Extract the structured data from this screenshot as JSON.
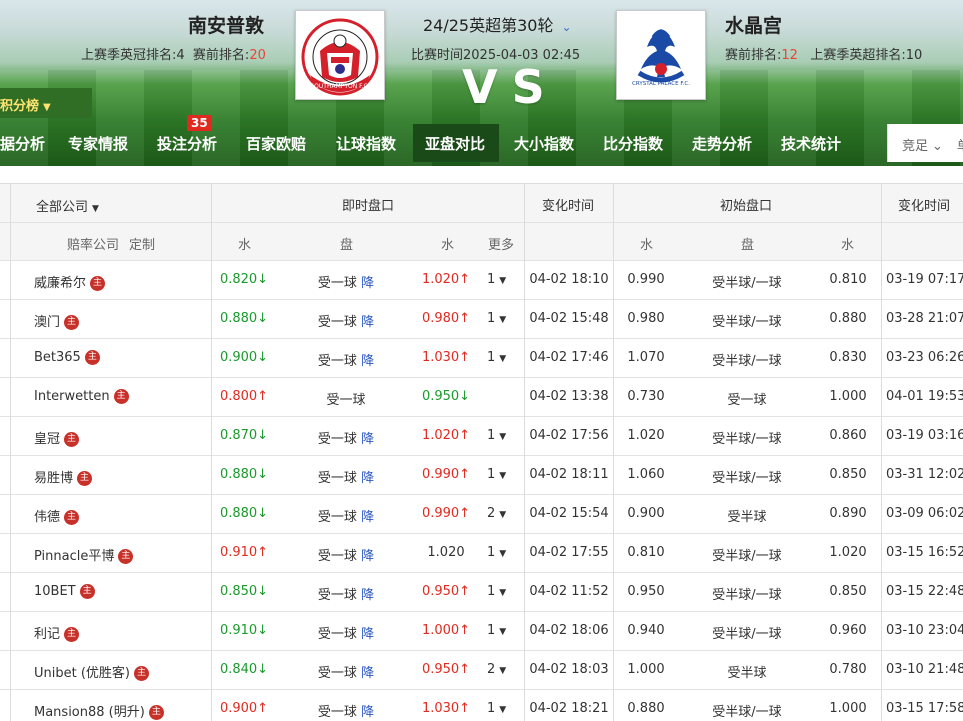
{
  "header": {
    "home_name": "南安普敦",
    "home_info_label1": "上赛季英冠排名:4",
    "home_info_label2": "赛前排名:",
    "home_rank": "20",
    "away_name": "水晶宫",
    "away_info_label1": "赛前排名:",
    "away_rank": "12",
    "away_info_label2": "上赛季英超排名:10",
    "round": "24/25英超第30轮",
    "match_time": "比赛时间2025-04-03 02:45",
    "vs": "VS",
    "rank_tab": "积分榜",
    "home_logo_text": "SOUTHAMPTON F.C.",
    "away_logo_text": "CRYSTAL PALACE F.C."
  },
  "nav": {
    "items": [
      "据分析",
      "专家情报",
      "投注分析",
      "百家欧赔",
      "让球指数",
      "亚盘对比",
      "大小指数",
      "比分指数",
      "走势分析",
      "技术统计"
    ],
    "badge": "35",
    "right_label": "竞足",
    "right_label2": "单"
  },
  "table": {
    "company_filter": "全部公司",
    "company_header": "赔率公司",
    "custom_label": "定制",
    "group_live": "即时盘口",
    "group_change_time": "变化时间",
    "group_initial": "初始盘口",
    "col_water": "水",
    "col_pan": "盘",
    "col_more": "更多",
    "home_mark": "主",
    "rows": [
      {
        "company": "威廉希尔",
        "w1": "0.820",
        "w1_dir": "down",
        "pan": "受一球",
        "pan_chg": "降",
        "w2": "1.020",
        "w2_dir": "up",
        "more": "1",
        "time": "04-02 18:10",
        "iw1": "0.990",
        "ipan": "受半球/一球",
        "iw2": "0.810",
        "itime": "03-19 07:17"
      },
      {
        "company": "澳门",
        "w1": "0.880",
        "w1_dir": "down",
        "pan": "受一球",
        "pan_chg": "降",
        "w2": "0.980",
        "w2_dir": "up",
        "more": "1",
        "time": "04-02 15:48",
        "iw1": "0.980",
        "ipan": "受半球/一球",
        "iw2": "0.880",
        "itime": "03-28 21:07"
      },
      {
        "company": "Bet365",
        "w1": "0.900",
        "w1_dir": "down",
        "pan": "受一球",
        "pan_chg": "降",
        "w2": "1.030",
        "w2_dir": "up",
        "more": "1",
        "time": "04-02 17:46",
        "iw1": "1.070",
        "ipan": "受半球/一球",
        "iw2": "0.830",
        "itime": "03-23 06:26"
      },
      {
        "company": "Interwetten",
        "w1": "0.800",
        "w1_dir": "up",
        "pan": "受一球",
        "pan_chg": "",
        "w2": "0.950",
        "w2_dir": "down",
        "more": "",
        "time": "04-02 13:38",
        "iw1": "0.730",
        "ipan": "受一球",
        "iw2": "1.000",
        "itime": "04-01 19:53"
      },
      {
        "company": "皇冠",
        "w1": "0.870",
        "w1_dir": "down",
        "pan": "受一球",
        "pan_chg": "降",
        "w2": "1.020",
        "w2_dir": "up",
        "more": "1",
        "time": "04-02 17:56",
        "iw1": "1.020",
        "ipan": "受半球/一球",
        "iw2": "0.860",
        "itime": "03-19 03:16"
      },
      {
        "company": "易胜博",
        "w1": "0.880",
        "w1_dir": "down",
        "pan": "受一球",
        "pan_chg": "降",
        "w2": "0.990",
        "w2_dir": "up",
        "more": "1",
        "time": "04-02 18:11",
        "iw1": "1.060",
        "ipan": "受半球/一球",
        "iw2": "0.850",
        "itime": "03-31 12:02"
      },
      {
        "company": "伟德",
        "w1": "0.880",
        "w1_dir": "down",
        "pan": "受一球",
        "pan_chg": "降",
        "w2": "0.990",
        "w2_dir": "up",
        "more": "2",
        "time": "04-02 15:54",
        "iw1": "0.900",
        "ipan": "受半球",
        "iw2": "0.890",
        "itime": "03-09 06:02"
      },
      {
        "company": "Pinnacle平博",
        "w1": "0.910",
        "w1_dir": "up",
        "pan": "受一球",
        "pan_chg": "降",
        "w2": "1.020",
        "w2_dir": "none",
        "more": "1",
        "time": "04-02 17:55",
        "iw1": "0.810",
        "ipan": "受半球/一球",
        "iw2": "1.020",
        "itime": "03-15 16:52"
      },
      {
        "company": "10BET",
        "w1": "0.850",
        "w1_dir": "down",
        "pan": "受一球",
        "pan_chg": "降",
        "w2": "0.950",
        "w2_dir": "up",
        "more": "1",
        "time": "04-02 11:52",
        "iw1": "0.950",
        "ipan": "受半球/一球",
        "iw2": "0.850",
        "itime": "03-15 22:48"
      },
      {
        "company": "利记",
        "w1": "0.910",
        "w1_dir": "down",
        "pan": "受一球",
        "pan_chg": "降",
        "w2": "1.000",
        "w2_dir": "up",
        "more": "1",
        "time": "04-02 18:06",
        "iw1": "0.940",
        "ipan": "受半球/一球",
        "iw2": "0.960",
        "itime": "03-10 23:04"
      },
      {
        "company": "Unibet (优胜客)",
        "w1": "0.840",
        "w1_dir": "down",
        "pan": "受一球",
        "pan_chg": "降",
        "w2": "0.950",
        "w2_dir": "up",
        "more": "2",
        "time": "04-02 18:03",
        "iw1": "1.000",
        "ipan": "受半球",
        "iw2": "0.780",
        "itime": "03-10 21:48"
      },
      {
        "company": "Mansion88 (明升)",
        "w1": "0.900",
        "w1_dir": "up",
        "pan": "受一球",
        "pan_chg": "降",
        "w2": "1.030",
        "w2_dir": "up",
        "more": "1",
        "time": "04-02 18:21",
        "iw1": "0.880",
        "ipan": "受半球/一球",
        "iw2": "1.000",
        "itime": "03-15 17:58"
      }
    ]
  }
}
